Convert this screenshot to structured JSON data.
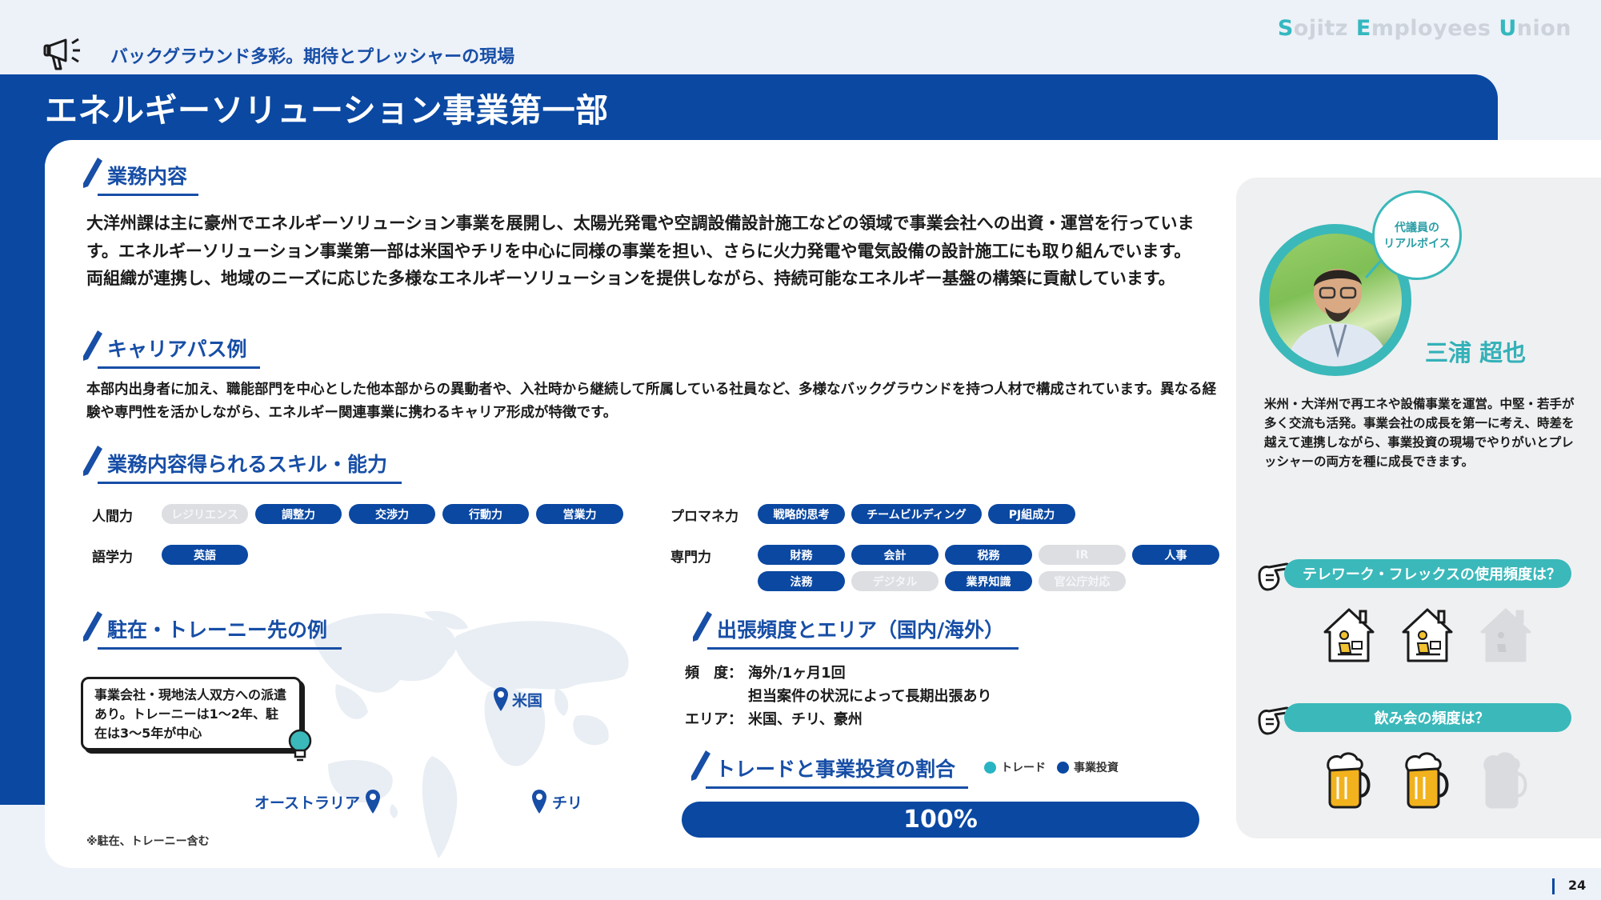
{
  "brand": {
    "s": "S",
    "ojitz": "ojitz ",
    "e": "E",
    "mployees": "mployees ",
    "u": "U",
    "nion": "nion"
  },
  "header": {
    "subtitle": "バックグラウンド多彩。期待とプレッシャーの現場",
    "title": "エネルギーソリューション事業第一部"
  },
  "sections": {
    "business": {
      "heading": "業務内容",
      "text": "大洋州課は主に豪州でエネルギーソリューション事業を展開し、太陽光発電や空調設備設計施工などの領域で事業会社への出資・運営を行っています。エネルギーソリューション事業第一部は米国やチリを中心に同様の事業を担い、さらに火力発電や電気設備の設計施工にも取り組んでいます。両組織が連携し、地域のニーズに応じた多様なエネルギーソリューションを提供しながら、持続可能なエネルギー基盤の構築に貢献しています。"
    },
    "career": {
      "heading": "キャリアパス例",
      "text": "本部内出身者に加え、職能部門を中心とした他本部からの異動者や、入社時から継続して所属している社員など、多様なバックグラウンドを持つ人材で構成されています。異なる経験や専門性を活かしながら、エネルギー関連事業に携わるキャリア形成が特徴です。"
    },
    "skills": {
      "heading": "業務内容得られるスキル・能力",
      "groups": [
        {
          "label": "人間力",
          "items": [
            {
              "name": "レジリエンス",
              "active": false
            },
            {
              "name": "調整力",
              "active": true
            },
            {
              "name": "交渉力",
              "active": true
            },
            {
              "name": "行動力",
              "active": true
            },
            {
              "name": "営業力",
              "active": true
            }
          ]
        },
        {
          "label": "語学力",
          "items": [
            {
              "name": "英語",
              "active": true
            }
          ]
        },
        {
          "label": "プロマネ力",
          "items": [
            {
              "name": "戦略的思考",
              "active": true
            },
            {
              "name": "チームビルディング",
              "active": true
            },
            {
              "name": "PJ組成力",
              "active": true
            }
          ]
        },
        {
          "label": "専門力",
          "items": [
            {
              "name": "財務",
              "active": true
            },
            {
              "name": "会計",
              "active": true
            },
            {
              "name": "税務",
              "active": true
            },
            {
              "name": "IR",
              "active": false
            },
            {
              "name": "人事",
              "active": true
            },
            {
              "name": "法務",
              "active": true
            },
            {
              "name": "デジタル",
              "active": false
            },
            {
              "name": "業界知識",
              "active": true
            },
            {
              "name": "官公庁対応",
              "active": false
            }
          ]
        }
      ]
    },
    "overseas": {
      "heading": "駐在・トレーニー先の例",
      "bubble": "事業会社・現地法人双方への派遣あり。トレーニーは1～2年、駐在は3～5年が中心",
      "locations": [
        "米国",
        "オーストラリア",
        "チリ"
      ],
      "note": "※駐在、トレーニー含む"
    },
    "trip": {
      "heading": "出張頻度とエリア（国内/海外）",
      "freq_label": "頻　度：",
      "freq_value": "海外/1ヶ月1回",
      "freq_sub": "担当案件の状況によって長期出張あり",
      "area_label": "エリア：",
      "area_value": "米国、チリ、豪州"
    },
    "ratio": {
      "heading": "トレードと事業投資の割合",
      "legend": [
        {
          "name": "トレード",
          "color": "#28b4c3"
        },
        {
          "name": "事業投資",
          "color": "#0a48a2"
        }
      ],
      "bar_label": "100%",
      "investment_share": 1.0
    }
  },
  "representative": {
    "badge_line1": "代議員の",
    "badge_line2": "リアルボイス",
    "name": "三浦 超也",
    "comment": "米州・大洋州で再エネや設備事業を運営。中堅・若手が多く交流も活発。事業会社の成長を第一に考え、時差を越えて連携しながら、事業投資の現場でやりがいとプレッシャーの両方を種に成長できます。",
    "q1": "テレワーク・フレックスの使用頻度は？",
    "q1_level": 2,
    "q1_max": 3,
    "q2": "飲み会の頻度は？",
    "q2_level": 2,
    "q2_max": 3
  },
  "page_number": "24",
  "colors": {
    "brand_blue": "#0a48a2",
    "teal": "#3bb8ba",
    "inactive": "#dcdee2"
  }
}
